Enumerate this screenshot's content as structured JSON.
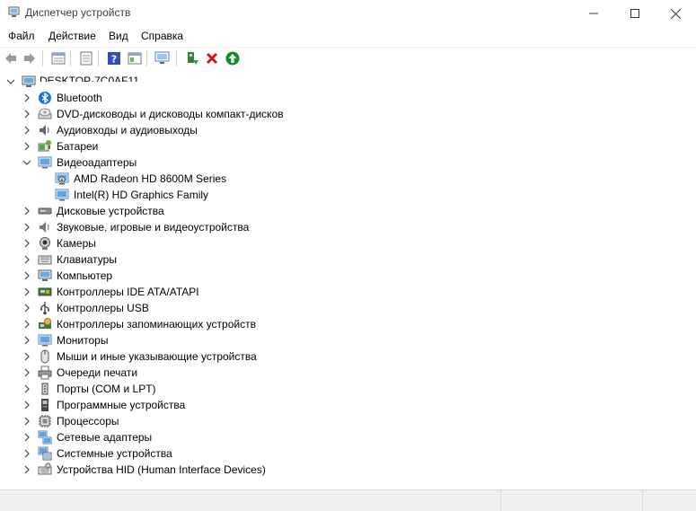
{
  "window": {
    "title": "Диспетчер устройств"
  },
  "menu": {
    "items": [
      "Файл",
      "Действие",
      "Вид",
      "Справка"
    ]
  },
  "tree": {
    "root": "DESKTOP-7C0AF11",
    "categories": [
      {
        "label": "Bluetooth",
        "icon": "bluetooth-icon"
      },
      {
        "label": "DVD-дисководы и дисководы компакт-дисков",
        "icon": "dvd-drive-icon"
      },
      {
        "label": "Аудиовходы и аудиовыходы",
        "icon": "speaker-icon"
      },
      {
        "label": "Батареи",
        "icon": "battery-icon"
      },
      {
        "label": "Видеоадаптеры",
        "icon": "display-adapter-icon",
        "expanded": true,
        "children": [
          "AMD Radeon HD 8600M Series",
          "Intel(R) HD Graphics Family"
        ]
      },
      {
        "label": "Дисковые устройства",
        "icon": "disk-drive-icon"
      },
      {
        "label": "Звуковые, игровые и видеоустройства",
        "icon": "sound-icon"
      },
      {
        "label": "Камеры",
        "icon": "camera-icon"
      },
      {
        "label": "Клавиатуры",
        "icon": "keyboard-icon"
      },
      {
        "label": "Компьютер",
        "icon": "computer-icon"
      },
      {
        "label": "Контроллеры IDE ATA/ATAPI",
        "icon": "ide-controller-icon"
      },
      {
        "label": "Контроллеры USB",
        "icon": "usb-icon"
      },
      {
        "label": "Контроллеры запоминающих устройств",
        "icon": "storage-controller-icon"
      },
      {
        "label": "Мониторы",
        "icon": "monitor-icon"
      },
      {
        "label": "Мыши и иные указывающие устройства",
        "icon": "mouse-icon"
      },
      {
        "label": "Очереди печати",
        "icon": "printer-icon"
      },
      {
        "label": "Порты (COM и LPT)",
        "icon": "port-icon"
      },
      {
        "label": "Программные устройства",
        "icon": "software-device-icon"
      },
      {
        "label": "Процессоры",
        "icon": "processor-icon"
      },
      {
        "label": "Сетевые адаптеры",
        "icon": "network-adapter-icon"
      },
      {
        "label": "Системные устройства",
        "icon": "system-device-icon"
      },
      {
        "label": "Устройства HID (Human Interface Devices)",
        "icon": "hid-icon"
      }
    ]
  }
}
